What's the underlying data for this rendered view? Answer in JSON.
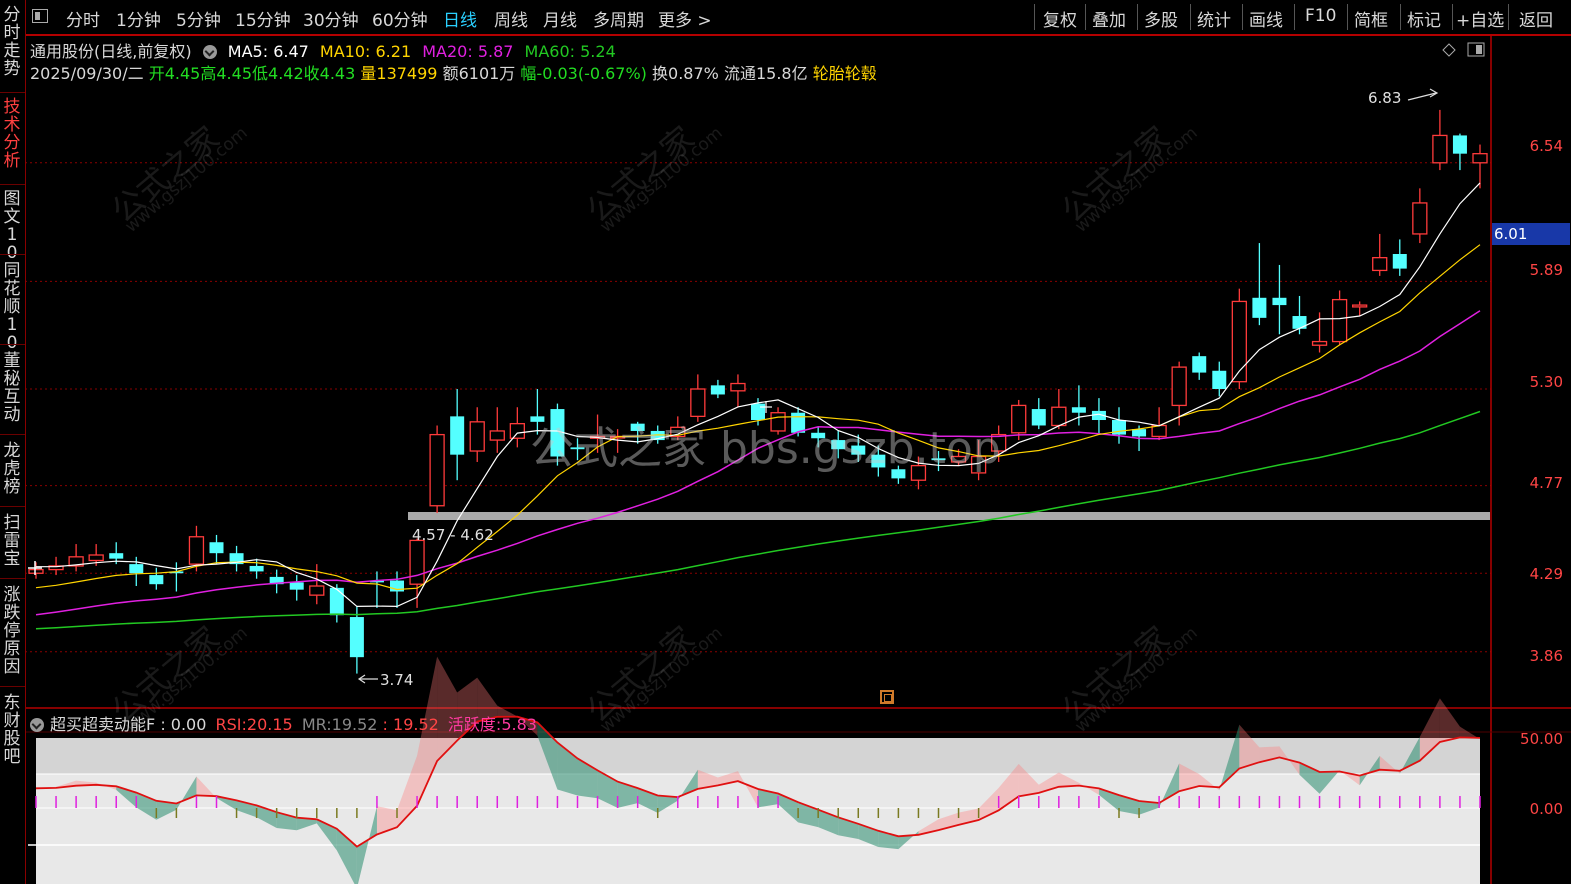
{
  "toolbar": {
    "tabs": [
      "分时",
      "1分钟",
      "5分钟",
      "15分钟",
      "30分钟",
      "60分钟",
      "日线",
      "周线",
      "月线",
      "多周期",
      "更多 >"
    ],
    "active_tab": "日线",
    "right_tools": [
      "复权",
      "叠加",
      "多股",
      "统计",
      "画线",
      "F10",
      "简框",
      "标记",
      "+自选",
      "返回"
    ]
  },
  "sidebar": {
    "items": [
      "分时走势",
      "技术分析",
      "图文10",
      "同花顺10",
      "董秘互动",
      "龙虎榜",
      "扫雷宝",
      "涨跌停原因",
      "东财股吧"
    ],
    "active_item": "技术分析"
  },
  "stock": {
    "name_line": "通用股份(日线,前复权)",
    "ma5_label": "MA5:",
    "ma5": "6.47",
    "ma10_label": "MA10:",
    "ma10": "6.21",
    "ma20_label": "MA20:",
    "ma20": "5.87",
    "ma60_label": "MA60:",
    "ma60": "5.24",
    "date": "2025/09/30/二",
    "open_label": "开",
    "open": "4.45",
    "high_label": "高",
    "high": "4.45",
    "low_label": "低",
    "low": "4.42",
    "close_label": "收",
    "close": "4.43",
    "volume_label": "量",
    "volume": "137499",
    "amount_label": "额",
    "amount": "6101万",
    "change_label": "幅",
    "change": "-0.03(-0.67%)",
    "turnover_label": "换",
    "turnover": "0.87%",
    "float_label": "流通",
    "float": "15.8亿",
    "concept": "轮胎轮毂"
  },
  "price_axis": [
    "6.54",
    "5.89",
    "5.30",
    "4.77",
    "4.29",
    "3.86"
  ],
  "current_price_tag": "6.01",
  "annotations": {
    "high_mark": "6.83",
    "low_mark": "3.74",
    "range_band": "4.57 - 4.62"
  },
  "indicator": {
    "name": "超买超卖动能F",
    "value": ": 0.00",
    "rsi_label": "RSI:",
    "rsi": "20.15",
    "mr_label": "MR:",
    "mr": "19.52",
    "mr2": ": 19.52",
    "activity_label": "活跃度:",
    "activity": "5.83",
    "axis": [
      "50.00",
      "0.00"
    ]
  },
  "watermark": {
    "center": "公式之家 bbs.gszb.top",
    "tile_main": "公式之家",
    "tile_sub": "www.gszj100.com"
  },
  "colors": {
    "up": "#ff3b3b",
    "down": "#54ffff",
    "ma5": "#ffffff",
    "ma10": "#ffd400",
    "ma20": "#e020e0",
    "ma60": "#22c822",
    "accent": "#2ad0ff"
  },
  "chart_data": {
    "type": "candlestick",
    "price_range": [
      3.65,
      6.95
    ],
    "candles": [
      [
        4.29,
        4.31,
        4.35,
        4.26
      ],
      [
        4.31,
        4.33,
        4.38,
        4.28
      ],
      [
        4.33,
        4.38,
        4.45,
        4.3
      ],
      [
        4.36,
        4.39,
        4.45,
        4.33
      ],
      [
        4.4,
        4.37,
        4.46,
        4.34
      ],
      [
        4.34,
        4.29,
        4.38,
        4.22
      ],
      [
        4.28,
        4.23,
        4.32,
        4.2
      ],
      [
        4.3,
        4.29,
        4.35,
        4.19
      ],
      [
        4.34,
        4.49,
        4.55,
        4.3
      ],
      [
        4.46,
        4.4,
        4.5,
        4.34
      ],
      [
        4.4,
        4.34,
        4.44,
        4.3
      ],
      [
        4.33,
        4.3,
        4.37,
        4.26
      ],
      [
        4.27,
        4.23,
        4.31,
        4.18
      ],
      [
        4.24,
        4.2,
        4.28,
        4.14
      ],
      [
        4.17,
        4.22,
        4.34,
        4.12
      ],
      [
        4.21,
        4.06,
        4.23,
        4.02
      ],
      [
        4.05,
        3.83,
        4.11,
        3.74
      ],
      [
        4.25,
        4.24,
        4.3,
        4.1
      ],
      [
        4.25,
        4.19,
        4.3,
        4.1
      ],
      [
        4.23,
        4.47,
        4.48,
        4.1
      ],
      [
        4.66,
        5.05,
        5.1,
        4.62
      ],
      [
        5.15,
        4.94,
        5.3,
        4.8
      ],
      [
        4.96,
        5.12,
        5.2,
        4.9
      ],
      [
        5.02,
        5.07,
        5.2,
        4.95
      ],
      [
        5.03,
        5.11,
        5.2,
        4.98
      ],
      [
        5.15,
        5.12,
        5.3,
        5.05
      ],
      [
        5.19,
        4.93,
        5.22,
        4.88
      ],
      [
        4.98,
        4.97,
        5.03,
        4.91
      ],
      [
        5.03,
        5.04,
        5.16,
        4.95
      ],
      [
        5.04,
        5.04,
        5.08,
        4.95
      ],
      [
        5.11,
        5.07,
        5.12,
        5.0
      ],
      [
        5.07,
        5.02,
        5.1,
        5.0
      ],
      [
        5.04,
        5.09,
        5.15,
        5.02
      ],
      [
        5.15,
        5.3,
        5.38,
        5.12
      ],
      [
        5.32,
        5.27,
        5.35,
        5.25
      ],
      [
        5.29,
        5.33,
        5.38,
        5.2
      ],
      [
        5.22,
        5.13,
        5.25,
        5.1
      ],
      [
        5.07,
        5.17,
        5.2,
        5.05
      ],
      [
        5.17,
        5.06,
        5.2,
        5.04
      ],
      [
        5.06,
        5.03,
        5.09,
        4.98
      ],
      [
        5.02,
        4.97,
        5.07,
        4.92
      ],
      [
        4.99,
        4.94,
        5.05,
        4.9
      ],
      [
        4.94,
        4.87,
        4.99,
        4.82
      ],
      [
        4.86,
        4.81,
        4.88,
        4.78
      ],
      [
        4.8,
        4.88,
        4.93,
        4.75
      ],
      [
        4.92,
        4.91,
        4.96,
        4.85
      ],
      [
        4.9,
        4.93,
        4.97,
        4.88
      ],
      [
        4.84,
        4.93,
        5.02,
        4.8
      ],
      [
        4.96,
        5.05,
        5.1,
        4.9
      ],
      [
        5.06,
        5.21,
        5.24,
        5.02
      ],
      [
        5.19,
        5.1,
        5.25,
        5.08
      ],
      [
        5.1,
        5.2,
        5.3,
        5.08
      ],
      [
        5.2,
        5.17,
        5.32,
        5.1
      ],
      [
        5.18,
        5.13,
        5.25,
        5.05
      ],
      [
        5.13,
        5.05,
        5.2,
        5.0
      ],
      [
        5.08,
        5.04,
        5.1,
        4.96
      ],
      [
        5.04,
        5.1,
        5.2,
        5.02
      ],
      [
        5.21,
        5.42,
        5.45,
        5.1
      ],
      [
        5.48,
        5.39,
        5.5,
        5.35
      ],
      [
        5.4,
        5.3,
        5.45,
        5.26
      ],
      [
        5.34,
        5.78,
        5.85,
        5.3
      ],
      [
        5.8,
        5.69,
        6.1,
        5.65
      ],
      [
        5.8,
        5.76,
        5.98,
        5.6
      ],
      [
        5.7,
        5.63,
        5.81,
        5.6
      ],
      [
        5.54,
        5.56,
        5.72,
        5.5
      ],
      [
        5.56,
        5.79,
        5.84,
        5.54
      ],
      [
        5.75,
        5.76,
        5.78,
        5.7
      ],
      [
        5.95,
        6.02,
        6.15,
        5.92
      ],
      [
        6.04,
        5.96,
        6.12,
        5.92
      ],
      [
        6.15,
        6.32,
        6.4,
        6.1
      ],
      [
        6.54,
        6.69,
        6.83,
        6.5
      ],
      [
        6.69,
        6.59,
        6.7,
        6.5
      ],
      [
        6.54,
        6.59,
        6.64,
        6.4
      ]
    ]
  }
}
